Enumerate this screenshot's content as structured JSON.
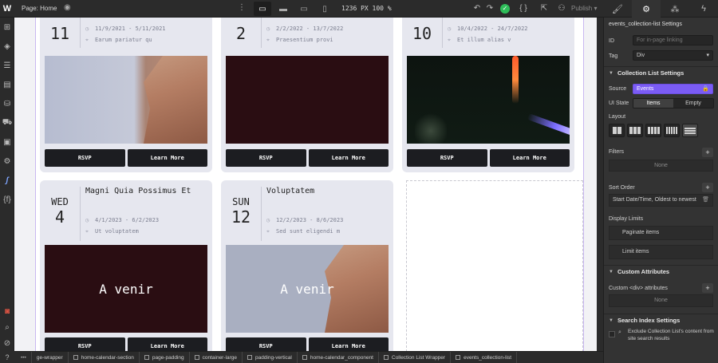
{
  "app": {
    "logo": "W",
    "page_label": "Page: Home"
  },
  "topbar": {
    "canvas_width": "1236 PX",
    "zoom": "100 %",
    "publish_label": "Publish",
    "publish_caret": "▾",
    "panel_tabs": [
      "style-brush",
      "settings-gear",
      "interactions",
      "lightning"
    ]
  },
  "cards": [
    {
      "day": "11",
      "dates": "11/9/2021 - 5/11/2021",
      "location": "Earum pariatur qu",
      "image": "sky",
      "overlay": "",
      "rsvp": "RSVP",
      "learn": "Learn More"
    },
    {
      "day": "2",
      "dates": "2/2/2022 - 13/7/2022",
      "location": "Praesentium provi",
      "image": "dark",
      "overlay": "",
      "rsvp": "RSVP",
      "learn": "Learn More"
    },
    {
      "day": "10",
      "dates": "10/4/2022 - 24/7/2022",
      "location": "Et illum alias v",
      "image": "night",
      "overlay": "",
      "rsvp": "RSVP",
      "learn": "Learn More"
    },
    {
      "dow": "WED",
      "day": "4",
      "title": "Magni Quia Possimus Et",
      "dates": "4/1/2023 - 6/2/2023",
      "location": "Ut voluptatem",
      "image": "dark",
      "overlay": "A venir",
      "rsvp": "RSVP",
      "learn": "Learn More"
    },
    {
      "dow": "SUN",
      "day": "12",
      "title": "Voluptatem",
      "dates": "12/2/2023 - 8/6/2023",
      "location": "Sed sunt eligendi m",
      "image": "sky",
      "overlay": "A venir",
      "rsvp": "RSVP",
      "learn": "Learn More"
    }
  ],
  "panel": {
    "element_title": "events_collection-list Settings",
    "id_label": "ID",
    "id_placeholder": "For in-page linking",
    "tag_label": "Tag",
    "tag_value": "Div",
    "collection_settings": "Collection List Settings",
    "source_label": "Source",
    "source_value": "Events",
    "ui_state_label": "UI State",
    "ui_state_items": "Items",
    "ui_state_empty": "Empty",
    "layout_label": "Layout",
    "filters_label": "Filters",
    "filters_none": "None",
    "sort_label": "Sort Order",
    "sort_value": "Start Date/Time, Oldest to newest",
    "display_limits": "Display Limits",
    "paginate": "Paginate items",
    "limit": "Limit items",
    "custom_attrs": "Custom Attributes",
    "custom_div": "Custom <div> attributes",
    "custom_none": "None",
    "search_index": "Search Index Settings",
    "exclude_text": "Exclude Collection List's content from site search results"
  },
  "breadcrumbs": [
    "ge-wrapper",
    "home-calendar-section",
    "page-padding",
    "container-large",
    "padding-vertical",
    "home-calendar_component",
    "Collection List Wrapper",
    "events_collection-list"
  ],
  "colors": {
    "accent": "#7b5cf5",
    "check": "#2ebd59",
    "button": "#1c1d21",
    "card": "#e6e7ef"
  }
}
